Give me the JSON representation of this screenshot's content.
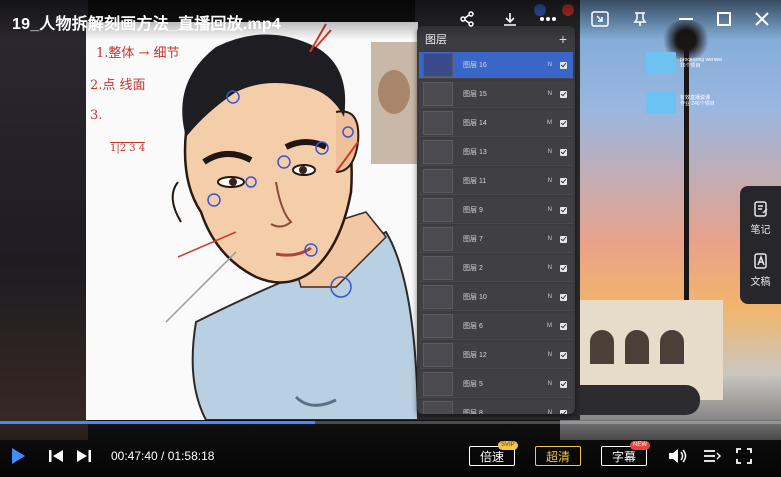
{
  "window": {
    "title": "19_人物拆解刻画方法_直播回放.mp4"
  },
  "top_icons": [
    "share-icon",
    "download-icon",
    "more-icon",
    "picture-in-picture-icon",
    "pin-icon",
    "minimize-icon",
    "maximize-icon",
    "close-icon"
  ],
  "layers_panel": {
    "title": "图层",
    "add_symbol": "+",
    "layers": [
      {
        "name": "图层 16",
        "mode": "N",
        "active": true
      },
      {
        "name": "图层 15",
        "mode": "N",
        "active": false
      },
      {
        "name": "图层 14",
        "mode": "M",
        "active": false
      },
      {
        "name": "图层 13",
        "mode": "N",
        "active": false
      },
      {
        "name": "图层 11",
        "mode": "N",
        "active": false
      },
      {
        "name": "图层 9",
        "mode": "N",
        "active": false
      },
      {
        "name": "图层 7",
        "mode": "N",
        "active": false
      },
      {
        "name": "图层 2",
        "mode": "N",
        "active": false
      },
      {
        "name": "图层 10",
        "mode": "N",
        "active": false
      },
      {
        "name": "图层 6",
        "mode": "M",
        "active": false
      },
      {
        "name": "图层 12",
        "mode": "N",
        "active": false
      },
      {
        "name": "图层 5",
        "mode": "N",
        "active": false
      },
      {
        "name": "图层 8",
        "mode": "N",
        "active": false
      }
    ]
  },
  "canvas_notes": {
    "line1": "1.整体 → 细节",
    "line2": "2.点 线面",
    "line3": "3.",
    "fraction": "1|2 3 4"
  },
  "desktop_folders": [
    {
      "name": "processing wenwei",
      "sub": "16个项目"
    },
    {
      "name": "有效直播说课",
      "sub": "作业 246个项目"
    }
  ],
  "side_panel": {
    "items": [
      {
        "label": "笔记",
        "icon": "note-icon"
      },
      {
        "label": "文稿",
        "icon": "transcript-icon"
      }
    ]
  },
  "player": {
    "current_time": "00:47:40",
    "separator": " / ",
    "duration": "01:58:18",
    "progress": 0.403,
    "speed_label": "倍速",
    "speed_badge": "SVIP",
    "quality_label": "超清",
    "subtitle_label": "字幕",
    "subtitle_badge": "NEW"
  },
  "colors": {
    "accent": "#3f8cff",
    "gold": "#f2c44c",
    "badge_red": "#e8443a",
    "active_layer": "#3a66c8"
  }
}
